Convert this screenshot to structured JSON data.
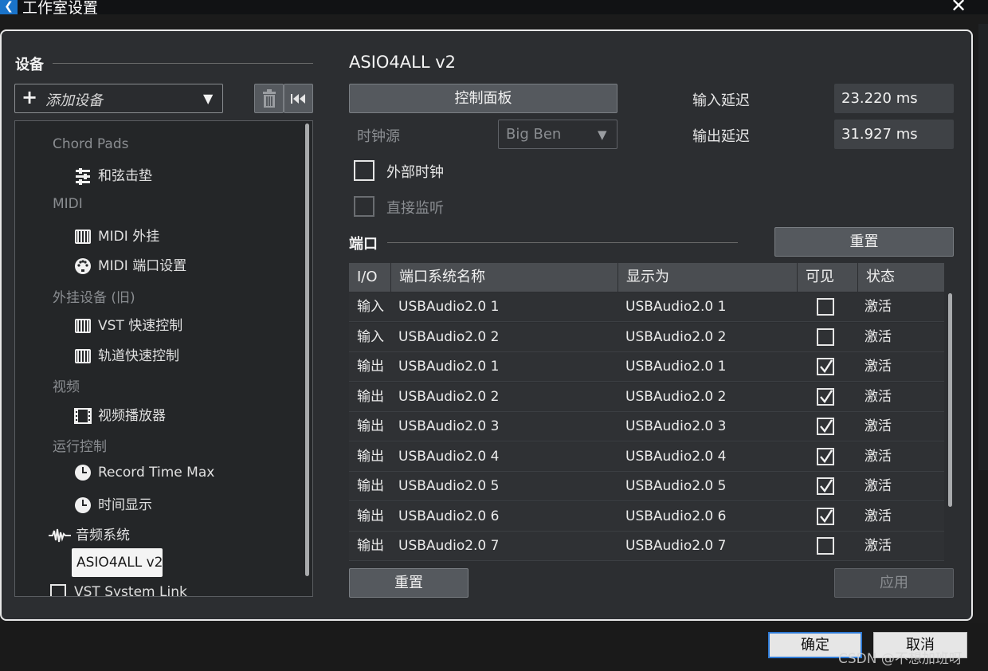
{
  "window": {
    "title": "工作室设置"
  },
  "devices": {
    "section_title": "设备",
    "add_device_label": "添加设备",
    "tree": {
      "chord_pads": "Chord Pads",
      "chord_pads_item": "和弦击垫",
      "midi": "MIDI",
      "midi_plugin": "MIDI 外挂",
      "midi_port_setup": "MIDI 端口设置",
      "external_old": "外挂设备 (旧)",
      "vst_quick_control": "VST 快速控制",
      "track_quick_control": "轨道快速控制",
      "video": "视频",
      "video_player": "视频播放器",
      "transport": "运行控制",
      "record_time_max": "Record Time Max",
      "time_display": "时间显示",
      "audio_system": "音频系统",
      "asio4all": "ASIO4ALL v2",
      "vst_system_link": "VST System Link"
    }
  },
  "driver": {
    "title": "ASIO4ALL v2",
    "control_panel_label": "控制面板",
    "clock_source_label": "时钟源",
    "clock_source_value": "Big Ben",
    "input_latency_label": "输入延迟",
    "input_latency_value": "23.220 ms",
    "output_latency_label": "输出延迟",
    "output_latency_value": "31.927 ms",
    "external_clock_label": "外部时钟",
    "direct_monitoring_label": "直接监听"
  },
  "ports": {
    "section_title": "端口",
    "reset_label": "重置",
    "columns": {
      "io": "I/O",
      "system_name": "端口系统名称",
      "display_as": "显示为",
      "visible": "可见",
      "state": "状态"
    },
    "rows": [
      {
        "io": "输入",
        "system_name": "USBAudio2.0 1",
        "display_as": "USBAudio2.0 1",
        "visible": false,
        "state": "激活"
      },
      {
        "io": "输入",
        "system_name": "USBAudio2.0 2",
        "display_as": "USBAudio2.0 2",
        "visible": false,
        "state": "激活"
      },
      {
        "io": "输出",
        "system_name": "USBAudio2.0 1",
        "display_as": "USBAudio2.0 1",
        "visible": true,
        "state": "激活"
      },
      {
        "io": "输出",
        "system_name": "USBAudio2.0 2",
        "display_as": "USBAudio2.0 2",
        "visible": true,
        "state": "激活"
      },
      {
        "io": "输出",
        "system_name": "USBAudio2.0 3",
        "display_as": "USBAudio2.0 3",
        "visible": true,
        "state": "激活"
      },
      {
        "io": "输出",
        "system_name": "USBAudio2.0 4",
        "display_as": "USBAudio2.0 4",
        "visible": true,
        "state": "激活"
      },
      {
        "io": "输出",
        "system_name": "USBAudio2.0 5",
        "display_as": "USBAudio2.0 5",
        "visible": true,
        "state": "激活"
      },
      {
        "io": "输出",
        "system_name": "USBAudio2.0 6",
        "display_as": "USBAudio2.0 6",
        "visible": true,
        "state": "激活"
      },
      {
        "io": "输出",
        "system_name": "USBAudio2.0 7",
        "display_as": "USBAudio2.0 7",
        "visible": false,
        "state": "激活"
      }
    ]
  },
  "bottom": {
    "reset_label": "重置",
    "apply_label": "应用"
  },
  "footer": {
    "ok_label": "确定",
    "cancel_label": "取消",
    "watermark": "CSDN @不想加班呀"
  },
  "colors": {
    "panel_bg": "#2c2e31",
    "button_bg": "#55595e",
    "accent_blue": "#1a73c9"
  }
}
